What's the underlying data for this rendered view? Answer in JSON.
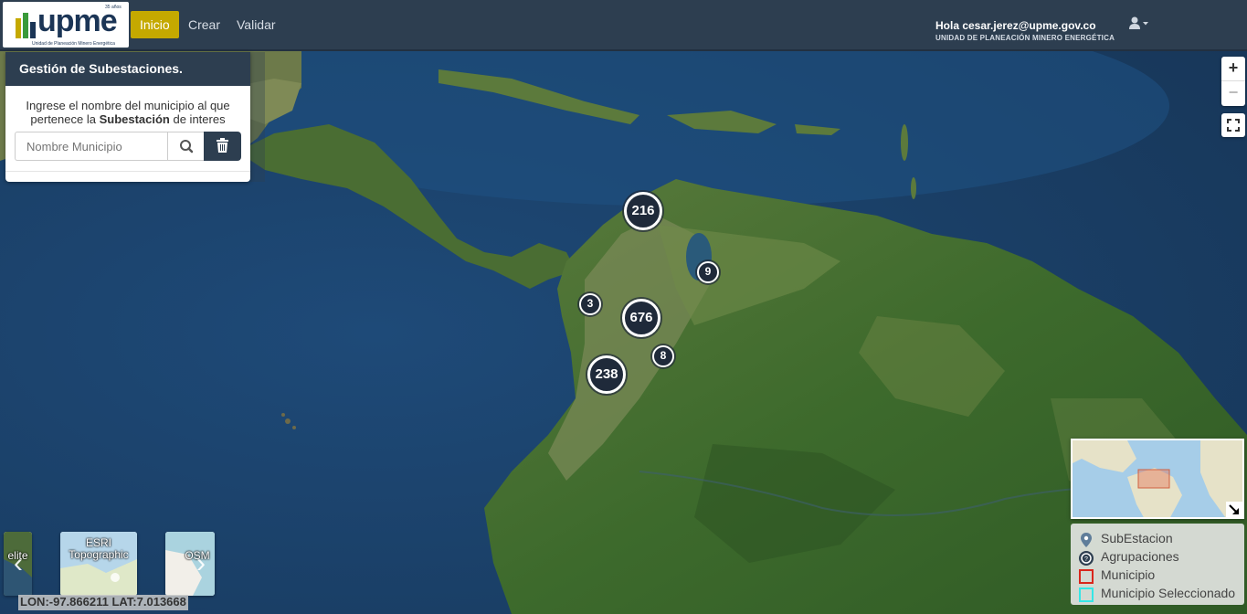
{
  "app": {
    "logo_text": "upme",
    "logo_subtitle": "Unidad de Planeación Minero Energética",
    "logo_tag": "35 años"
  },
  "nav": {
    "items": [
      {
        "label": "Inicio",
        "active": true
      },
      {
        "label": "Crear",
        "active": false
      },
      {
        "label": "Validar",
        "active": false
      }
    ]
  },
  "user": {
    "greeting": "Hola cesar.jerez@upme.gov.co",
    "organization": "UNIDAD DE PLANEACIÓN MINERO ENERGÉTICA",
    "menu_icon": "user-icon"
  },
  "panel": {
    "title": "Gestión de Subestaciones.",
    "instruction_before": "Ingrese el nombre del municipio al que pertenece la ",
    "instruction_bold": "Subestación",
    "instruction_after": " de interes",
    "search_placeholder": "Nombre Municipio",
    "search_icon": "search-icon",
    "delete_icon": "trash-icon"
  },
  "map": {
    "zoom_in": "+",
    "zoom_out": "−",
    "clusters": [
      {
        "count": "216",
        "size": "big"
      },
      {
        "count": "9",
        "size": "small"
      },
      {
        "count": "3",
        "size": "small"
      },
      {
        "count": "676",
        "size": "big"
      },
      {
        "count": "8",
        "size": "small"
      },
      {
        "count": "238",
        "size": "big"
      }
    ],
    "coordinates": "LON:-97.866211 LAT:7.013668"
  },
  "legend": {
    "items": [
      {
        "label": "SubEstacion",
        "icon": "map-pin-icon",
        "color": "#5f7d9a"
      },
      {
        "label": "Agrupaciones",
        "icon": "cluster-icon",
        "color": "#2d3e50"
      },
      {
        "label": "Municipio",
        "icon": "square-outline-icon",
        "color": "#d9261c"
      },
      {
        "label": "Municipio Seleccionado",
        "icon": "square-outline-icon",
        "color": "#35e6e6"
      }
    ]
  },
  "basemaps": {
    "items": [
      {
        "label": "elite"
      },
      {
        "label": "ESRI Topographic"
      },
      {
        "label": "OSM"
      }
    ]
  },
  "colors": {
    "navbar": "#2d3e50",
    "active_nav": "#c5a900",
    "ocean": "#1a3f66",
    "land": "#3f6a2e"
  }
}
